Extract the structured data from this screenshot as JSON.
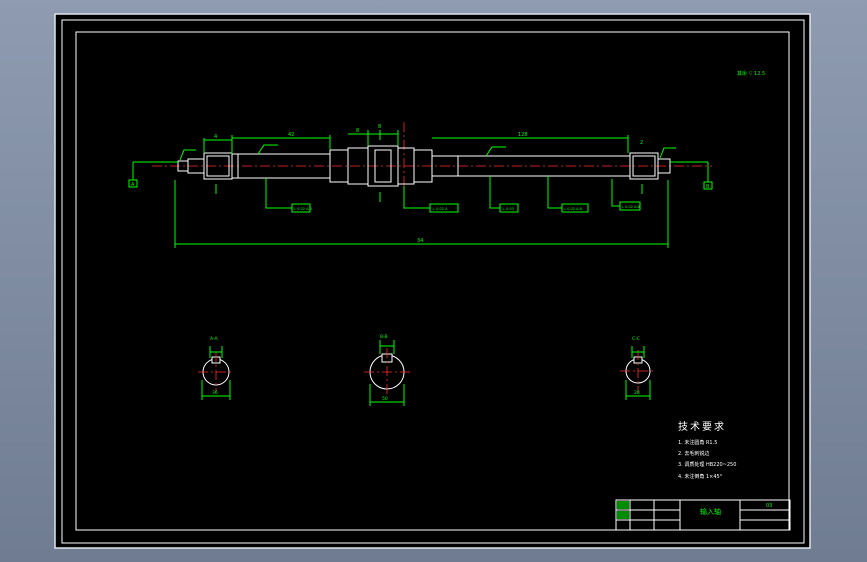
{
  "drawing": {
    "top_roughness": "其余 ▽ 12.5",
    "total_length": "34",
    "dim_labels": [
      "42",
      "8",
      "8",
      "128",
      "4",
      "2"
    ],
    "tolerance_boxes": [
      "⊥ 0.02 A-B",
      "⊥ 0.02 A",
      "⊥ 0.03",
      "⊥ 0.02 A-B",
      "⊥ 0.02 A-B"
    ],
    "datum_left": "A",
    "datum_right": "B",
    "section_labels": [
      "A-A",
      "B-B",
      "C-C"
    ],
    "section_dims": [
      "36",
      "50",
      "28"
    ]
  },
  "tech_requirements": {
    "title": "技术要求",
    "items": [
      "1. 未注圆角 R1.5",
      "2. 去毛刺锐边",
      "3. 调质处理 HB220~250",
      "4. 未注倒角 1×45°"
    ]
  },
  "title_block": {
    "name": "输入轴",
    "code": "03"
  }
}
